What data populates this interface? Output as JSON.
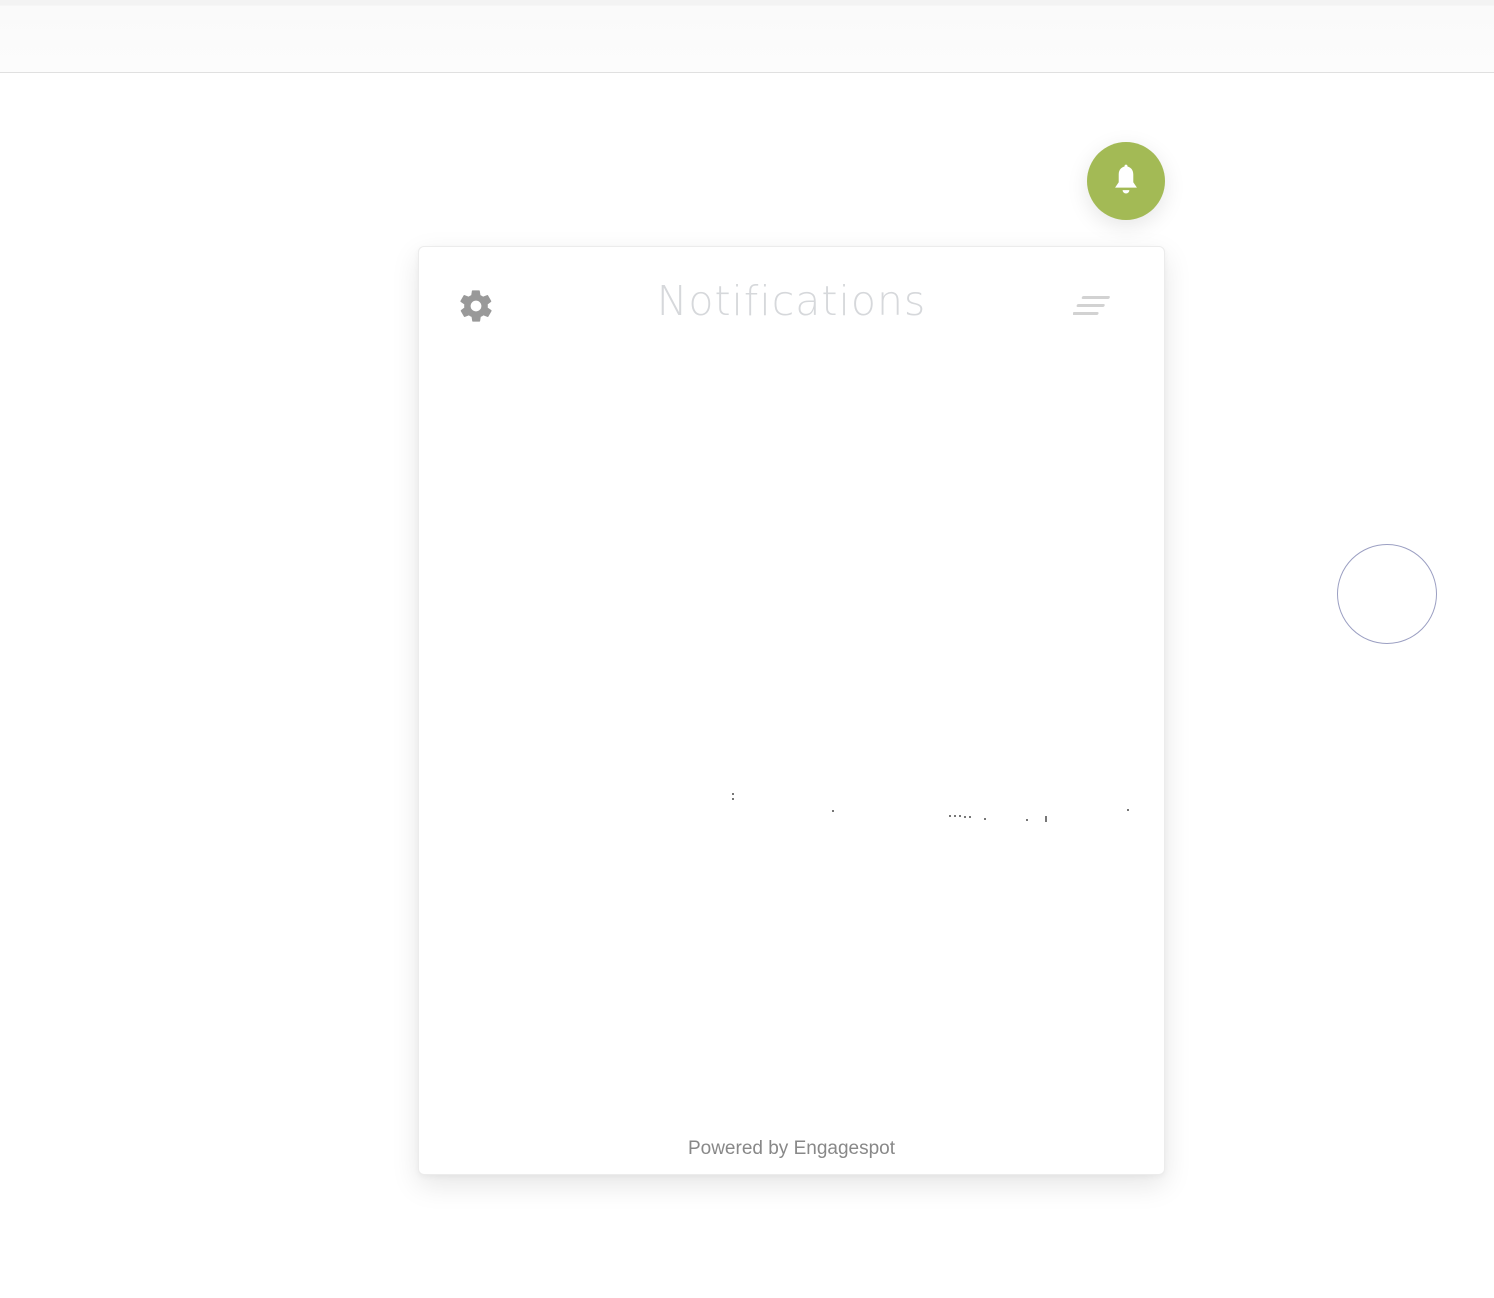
{
  "topbar": {},
  "bell": {
    "icon": "bell-icon",
    "color": "#a3ba55"
  },
  "panel": {
    "title": "Notifications",
    "settings_icon": "gear-icon",
    "menu_icon": "lines-icon",
    "footer": "Powered by Engagespot"
  }
}
